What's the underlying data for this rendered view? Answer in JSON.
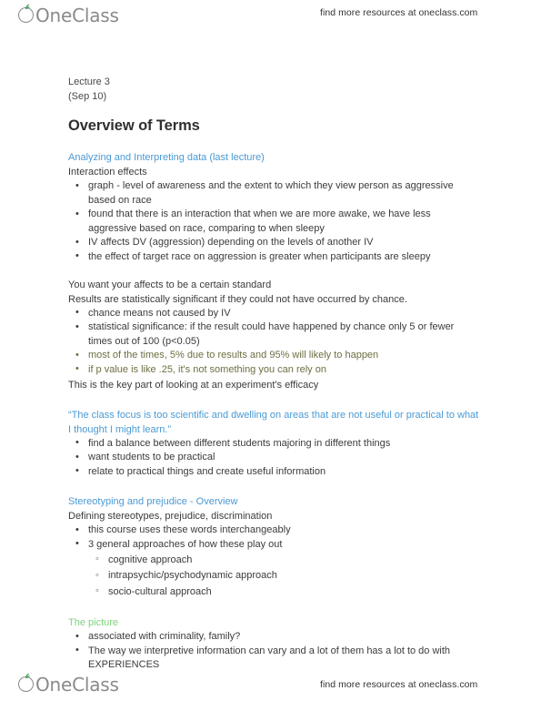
{
  "brand": {
    "name": "OneClass",
    "tagline": "find more resources at oneclass.com",
    "logo_icon": "oneclass-apple-logo",
    "colors": {
      "logo_gray": "#8a8a8a",
      "leaf_green": "#3f9b52",
      "heading_blue": "#4a9ad4",
      "heading_green": "#7fd17f",
      "highlight_olive": "#6e6e42",
      "body_text": "#3b3b3b"
    }
  },
  "document": {
    "lecture_label": "Lecture 3",
    "lecture_date": "(Sep 10)",
    "title": "Overview of Terms",
    "sections": [
      {
        "heading": "Analyzing and Interpreting data (last lecture)",
        "heading_color": "blue",
        "subheading": "Interaction effects",
        "bullets": [
          "graph - level of awareness and the extent to which they view person as aggressive based on race",
          "found that there is an interaction that when we are more awake, we have less aggressive based on race, comparing to when sleepy",
          "IV affects DV (aggression) depending on the levels of another IV",
          "the effect of target race on aggression is greater when participants are sleepy"
        ]
      },
      {
        "lines": [
          "You want your affects to be a certain standard",
          "Results are statistically significant if they could not have occurred by chance."
        ],
        "bullets": [
          {
            "text": "chance means not caused by IV",
            "style": "normal"
          },
          {
            "text": "statistical significance: if the result could have happened by chance only 5 or fewer times out of 100 (p<0.05)",
            "style": "normal"
          },
          {
            "text": "most of the times, 5% due to results and 95% will likely to happen",
            "style": "olive"
          },
          {
            "text": "if p value is like .25, it's not something you can rely on",
            "style": "olive"
          }
        ],
        "closing_line": "This is the key part of looking at an experiment's efficacy"
      },
      {
        "quote": "“The class focus is too scientific and dwelling on areas that are not useful or practical to what I thought I might learn.”",
        "quote_color": "blue",
        "bullets": [
          "find a balance between different students majoring in different things",
          "want students to be practical",
          "relate to practical things and create useful information"
        ]
      },
      {
        "heading": "Stereotyping and prejudice - Overview",
        "heading_color": "blue",
        "subheading": "Defining stereotypes, prejudice, discrimination",
        "bullets": [
          "this course uses these words interchangeably",
          "3 general approaches of how these play out"
        ],
        "subbullets": [
          "cognitive approach",
          "intrapsychic/psychodynamic approach",
          "socio-cultural approach"
        ]
      },
      {
        "heading": "The picture",
        "heading_color": "green",
        "bullets": [
          "associated with criminality, family?",
          "The way we interpretive information can vary and a lot of them has a lot to do with EXPERIENCES"
        ]
      }
    ]
  }
}
